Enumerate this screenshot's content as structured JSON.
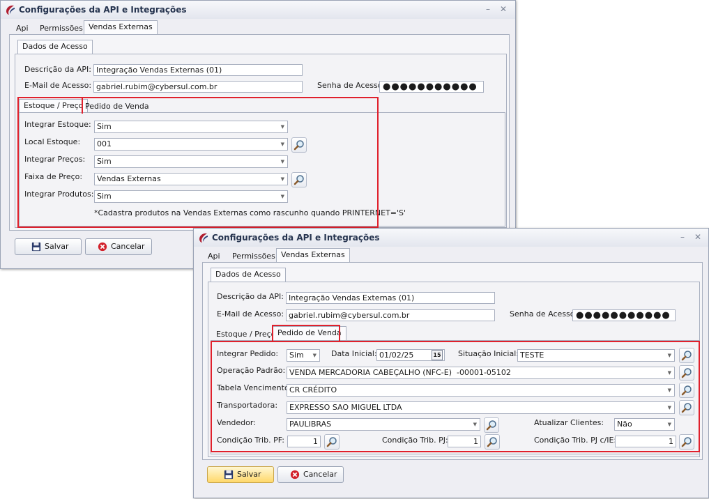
{
  "window1": {
    "title": "Configurações da API e Integrações",
    "tabs": [
      "Api",
      "Permissões",
      "Vendas Externas"
    ],
    "subtab": "Dados de Acesso",
    "api_desc_label": "Descrição da API:",
    "api_desc_value": "Integração Vendas Externas (01)",
    "email_label": "E-Mail de Acesso:",
    "email_value": "gabriel.rubim@cybersul.com.br",
    "senha_label": "Senha de Acesso:",
    "senha_value": "●●●●●●●●●●●",
    "inner_tabs": [
      "Estoque / Preço",
      "Pedido de Venda"
    ],
    "estoque": {
      "integrar_estoque_label": "Integrar Estoque:",
      "integrar_estoque_value": "Sim",
      "local_estoque_label": "Local Estoque:",
      "local_estoque_value": "001",
      "integrar_precos_label": "Integrar Preços:",
      "integrar_precos_value": "Sim",
      "faixa_preco_label": "Faixa de Preço:",
      "faixa_preco_value": "Vendas Externas",
      "integrar_produtos_label": "Integrar Produtos:",
      "integrar_produtos_value": "Sim",
      "note": "*Cadastra produtos na Vendas Externas como rascunho quando PRINTERNET='S'"
    },
    "salvar_label": "Salvar",
    "cancelar_label": "Cancelar"
  },
  "window2": {
    "title": "Configurações da API e Integrações",
    "tabs": [
      "Api",
      "Permissões",
      "Vendas Externas"
    ],
    "subtab": "Dados de Acesso",
    "api_desc_label": "Descrição da API:",
    "api_desc_value": "Integração Vendas Externas (01)",
    "email_label": "E-Mail de Acesso:",
    "email_value": "gabriel.rubim@cybersul.com.br",
    "senha_label": "Senha de Acesso:",
    "senha_value": "●●●●●●●●●●●",
    "inner_tabs": [
      "Estoque / Preço",
      "Pedido de Venda"
    ],
    "pedido": {
      "integrar_pedido_label": "Integrar Pedido:",
      "integrar_pedido_value": "Sim",
      "data_inicial_label": "Data Inicial:",
      "data_inicial_value": "01/02/25",
      "date_icon_text": "15",
      "situacao_inicial_label": "Situação Inicial:",
      "situacao_inicial_value": "TESTE",
      "operacao_label": "Operação Padrão:",
      "operacao_value": "VENDA MERCADORIA CABEÇALHO (NFC-E)",
      "operacao_code": "-00001-05102",
      "tabela_label": "Tabela Vencimento:",
      "tabela_value": "CR CRÉDITO",
      "transportadora_label": "Transportadora:",
      "transportadora_value": "EXPRESSO SAO MIGUEL LTDA",
      "vendedor_label": "Vendedor:",
      "vendedor_value": "PAULIBRAS",
      "atualizar_label": "Atualizar Clientes:",
      "atualizar_value": "Não",
      "cond_pf_label": "Condição Trib. PF:",
      "cond_pf_value": "1",
      "cond_pj_label": "Condição Trib. PJ:",
      "cond_pj_value": "1",
      "cond_pjie_label": "Condição Trib. PJ c/IE:",
      "cond_pjie_value": "1"
    },
    "salvar_label": "Salvar",
    "cancelar_label": "Cancelar"
  },
  "colors": {
    "highlight": "#e0202c",
    "title_text": "#26344f",
    "default_button": "#ffd86a"
  },
  "icons": [
    "app-logo-icon",
    "magnifier-icon",
    "floppy-disk-icon",
    "cancel-x-icon",
    "calendar-icon",
    "combo-arrow-icon"
  ]
}
